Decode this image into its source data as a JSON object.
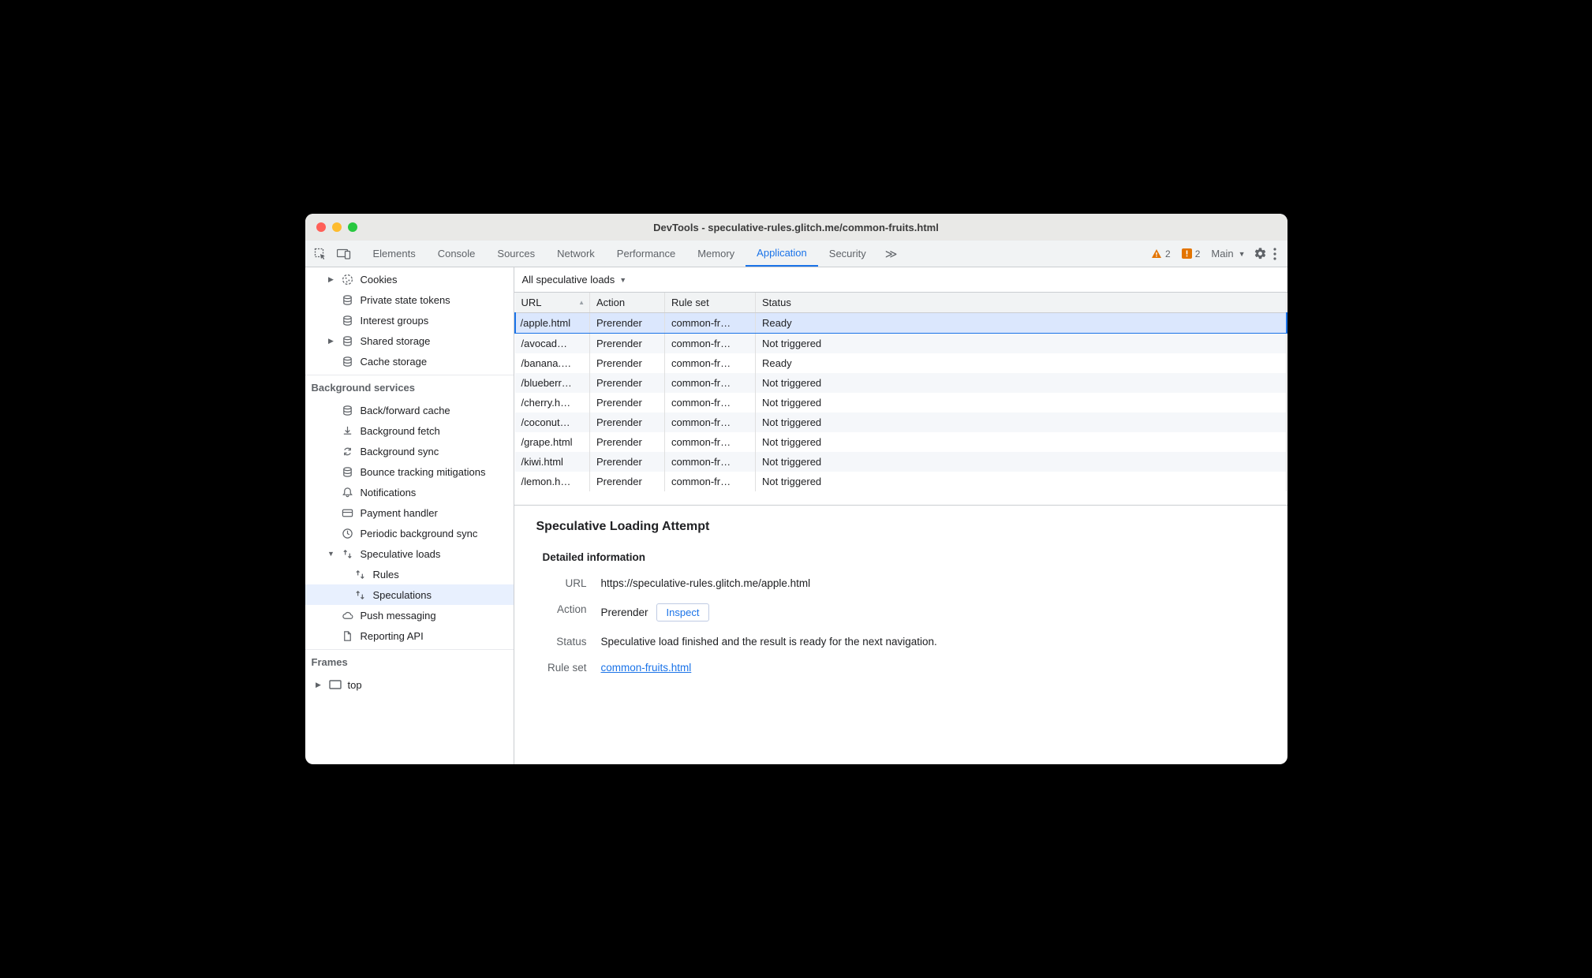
{
  "window": {
    "title": "DevTools - speculative-rules.glitch.me/common-fruits.html"
  },
  "toolbar": {
    "tabs": [
      "Elements",
      "Console",
      "Sources",
      "Network",
      "Performance",
      "Memory",
      "Application",
      "Security"
    ],
    "active_tab": "Application",
    "overflow_glyph": "≫",
    "warnings_count": "2",
    "issues_count": "2",
    "context_label": "Main"
  },
  "sidebar": {
    "storage_items": [
      {
        "label": "Cookies",
        "icon": "cookie",
        "expandable": true
      },
      {
        "label": "Private state tokens",
        "icon": "db"
      },
      {
        "label": "Interest groups",
        "icon": "db"
      },
      {
        "label": "Shared storage",
        "icon": "db",
        "expandable": true
      },
      {
        "label": "Cache storage",
        "icon": "db"
      }
    ],
    "bg_heading": "Background services",
    "bg_items": [
      {
        "label": "Back/forward cache",
        "icon": "db"
      },
      {
        "label": "Background fetch",
        "icon": "fetch"
      },
      {
        "label": "Background sync",
        "icon": "sync"
      },
      {
        "label": "Bounce tracking mitigations",
        "icon": "db"
      },
      {
        "label": "Notifications",
        "icon": "bell"
      },
      {
        "label": "Payment handler",
        "icon": "card"
      },
      {
        "label": "Periodic background sync",
        "icon": "clock"
      },
      {
        "label": "Speculative loads",
        "icon": "updown",
        "expandable": true,
        "expanded": true,
        "children": [
          {
            "label": "Rules",
            "icon": "updown"
          },
          {
            "label": "Speculations",
            "icon": "updown",
            "selected": true
          }
        ]
      },
      {
        "label": "Push messaging",
        "icon": "cloud"
      },
      {
        "label": "Reporting API",
        "icon": "doc"
      }
    ],
    "frames_heading": "Frames",
    "frames_items": [
      {
        "label": "top",
        "icon": "frame",
        "expandable": true
      }
    ]
  },
  "filter": {
    "label": "All speculative loads"
  },
  "table": {
    "headers": {
      "url": "URL",
      "action": "Action",
      "rule": "Rule set",
      "status": "Status"
    },
    "rows": [
      {
        "url": "/apple.html",
        "action": "Prerender",
        "rule": "common-fr…",
        "status": "Ready",
        "selected": true
      },
      {
        "url": "/avocad…",
        "action": "Prerender",
        "rule": "common-fr…",
        "status": "Not triggered"
      },
      {
        "url": "/banana.…",
        "action": "Prerender",
        "rule": "common-fr…",
        "status": "Ready"
      },
      {
        "url": "/blueberr…",
        "action": "Prerender",
        "rule": "common-fr…",
        "status": "Not triggered"
      },
      {
        "url": "/cherry.h…",
        "action": "Prerender",
        "rule": "common-fr…",
        "status": "Not triggered"
      },
      {
        "url": "/coconut…",
        "action": "Prerender",
        "rule": "common-fr…",
        "status": "Not triggered"
      },
      {
        "url": "/grape.html",
        "action": "Prerender",
        "rule": "common-fr…",
        "status": "Not triggered"
      },
      {
        "url": "/kiwi.html",
        "action": "Prerender",
        "rule": "common-fr…",
        "status": "Not triggered"
      },
      {
        "url": "/lemon.h…",
        "action": "Prerender",
        "rule": "common-fr…",
        "status": "Not triggered"
      }
    ]
  },
  "detail": {
    "title": "Speculative Loading Attempt",
    "subtitle": "Detailed information",
    "url_label": "URL",
    "action_label": "Action",
    "status_label": "Status",
    "ruleset_label": "Rule set",
    "url": "https://speculative-rules.glitch.me/apple.html",
    "action": "Prerender",
    "inspect_btn": "Inspect",
    "status": "Speculative load finished and the result is ready for the next navigation.",
    "ruleset_link": "common-fruits.html"
  }
}
